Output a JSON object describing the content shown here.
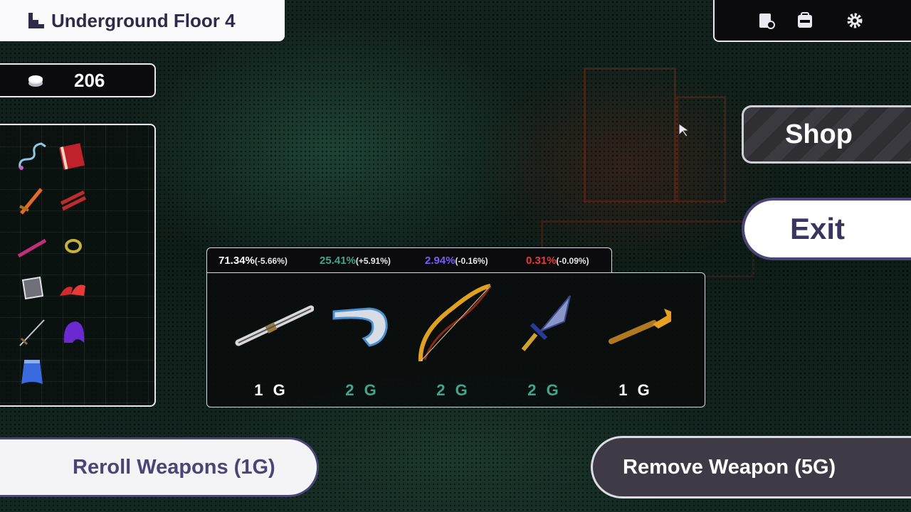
{
  "floor": {
    "title": "Underground Floor 4",
    "icon": "stairs-icon"
  },
  "gold": {
    "amount": "206",
    "icon": "coin-stack-icon"
  },
  "top_bar": {
    "icons": [
      "map-icon",
      "backpack-icon",
      "gear-icon"
    ]
  },
  "inventory": {
    "items": [
      "whip-chain",
      "red-tome",
      "orange-sword",
      "red-claws",
      "pink-wand",
      "gold-ring",
      "stone-armor",
      "red-boots",
      "thin-sword",
      "purple-hood",
      "blue-cloak"
    ]
  },
  "shop": {
    "label": "Shop"
  },
  "exit": {
    "label": "Exit"
  },
  "rarity_odds": [
    {
      "percent": "71.34%",
      "delta": "(-5.66%)",
      "color": "#ffffff"
    },
    {
      "percent": "25.41%",
      "delta": "(+5.91%)",
      "color": "#3fa68c"
    },
    {
      "percent": "2.94%",
      "delta": "(-0.16%)",
      "color": "#7a5cf0"
    },
    {
      "percent": "0.31%",
      "delta": "(-0.09%)",
      "color": "#e53a3a"
    }
  ],
  "weapons": [
    {
      "name": "staff",
      "price": "1 G",
      "color": "#ffffff"
    },
    {
      "name": "boomerang",
      "price": "2 G",
      "color": "#3fa68c"
    },
    {
      "name": "bow",
      "price": "2 G",
      "color": "#3fa68c"
    },
    {
      "name": "dagger",
      "price": "2 G",
      "color": "#3fa68c"
    },
    {
      "name": "torch-club",
      "price": "1 G",
      "color": "#ffffff"
    }
  ],
  "actions": {
    "reroll": "Reroll Weapons (1G)",
    "remove": "Remove Weapon (5G)"
  }
}
